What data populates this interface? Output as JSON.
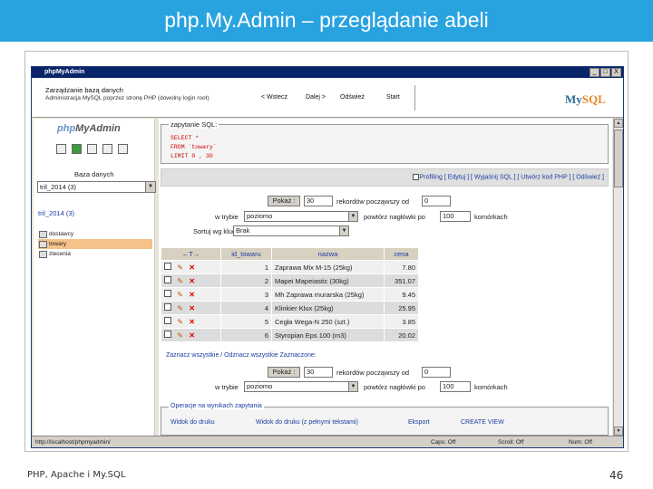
{
  "slide": {
    "title": "php.My.Admin – przeglądanie abeli",
    "footer_left": "PHP, Apache i My.SQL",
    "page_number": "46",
    "header_color": "#29a3e0"
  },
  "window": {
    "title": "phpMyAdmin",
    "controls": [
      "_",
      "□",
      "X"
    ]
  },
  "toolbar": {
    "heading": "Zarządzanie bazą danych",
    "subtitle": "Administracja MySQL poprzez stronę PHP (dowolny login root)",
    "back_label": "< Wstecz",
    "forward_label": "Dalej >",
    "refresh_label": "Odśwież",
    "start_label": "Start",
    "logo_text_a": "My",
    "logo_text_b": "SQL"
  },
  "sidebar": {
    "logo_a": "php",
    "logo_b": "MyAdmin",
    "db_label": "Baza danych",
    "db_selected": "tril_2014 (3)",
    "db_link": "tril_2014 (3)",
    "tables": [
      {
        "label": "dostawcy"
      },
      {
        "label": "towary"
      },
      {
        "label": "zlecenia"
      }
    ]
  },
  "query": {
    "legend": "zapytanie SQL:",
    "line1": "SELECT *",
    "line2": "FROM `towary`",
    "line3": "LIMIT 0 , 30",
    "links": "Profiling [ Edytuj ] [ Wyjaśnij SQL ] [ Utwórz kod PHP ] [ Odśwież ]"
  },
  "nav_top": {
    "show_label": "Pokaż :",
    "count": "30",
    "rows_from": "rekordów począwszy od",
    "start": "0",
    "mode_label": "w trybie",
    "mode": "poziomo",
    "repeat_label": "powtórz nagłówki po",
    "repeat": "100",
    "cells_label": "komórkach",
    "sort_label": "Sortuj wg klucza:",
    "sort_value": "Brak"
  },
  "table": {
    "headers": [
      "id_towaru",
      "nazwa",
      "cena"
    ],
    "rows": [
      {
        "id": "1",
        "nazwa": "Zaprawa Mix M-15 (25kg)",
        "cena": "7.80"
      },
      {
        "id": "2",
        "nazwa": "Mapei Mapeiastic (30kg)",
        "cena": "351.07"
      },
      {
        "id": "3",
        "nazwa": "Mh Zaprawa murarska (25kg)",
        "cena": "9.45"
      },
      {
        "id": "4",
        "nazwa": "Klinkier Klux (25kg)",
        "cena": "25.95"
      },
      {
        "id": "5",
        "nazwa": "Cegła Wega-N 250 (szt.)",
        "cena": "3.85"
      },
      {
        "id": "6",
        "nazwa": "Styropian Eps 100 (m3)",
        "cena": "20.02"
      }
    ],
    "mark_all": "Zaznacz wszystkie / Odznacz wszystkie  Zaznaczone:"
  },
  "nav_bottom": {
    "show_label": "Pokaż :",
    "count": "30",
    "rows_from": "rekordów począwszy od",
    "start": "0",
    "mode_label": "w trybie",
    "mode": "poziomo",
    "repeat_label": "powtórz nagłówki po",
    "repeat": "100",
    "cells_label": "komórkach"
  },
  "ops": {
    "legend": "Operacje na wynikach zapytania",
    "print": "Widok do druku",
    "print_full": "Widok do druku (z pełnymi tekstami)",
    "export": "Eksport",
    "create_view": "CREATE VIEW"
  },
  "statusbar": {
    "url": "http://localhost/phpmyadmin/",
    "caps": "Caps: Off",
    "scroll": "Scroll: Off",
    "num": "Num: Off"
  }
}
